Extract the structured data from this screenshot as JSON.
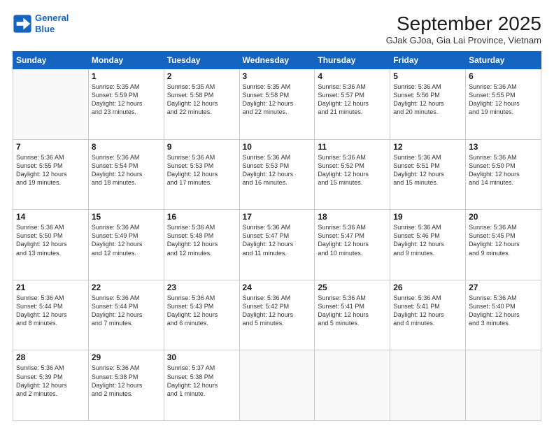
{
  "header": {
    "logo_line1": "General",
    "logo_line2": "Blue",
    "month_title": "September 2025",
    "location": "GJak GJoa, Gia Lai Province, Vietnam"
  },
  "days_of_week": [
    "Sunday",
    "Monday",
    "Tuesday",
    "Wednesday",
    "Thursday",
    "Friday",
    "Saturday"
  ],
  "weeks": [
    [
      {
        "day": "",
        "info": ""
      },
      {
        "day": "1",
        "info": "Sunrise: 5:35 AM\nSunset: 5:59 PM\nDaylight: 12 hours\nand 23 minutes."
      },
      {
        "day": "2",
        "info": "Sunrise: 5:35 AM\nSunset: 5:58 PM\nDaylight: 12 hours\nand 22 minutes."
      },
      {
        "day": "3",
        "info": "Sunrise: 5:35 AM\nSunset: 5:58 PM\nDaylight: 12 hours\nand 22 minutes."
      },
      {
        "day": "4",
        "info": "Sunrise: 5:36 AM\nSunset: 5:57 PM\nDaylight: 12 hours\nand 21 minutes."
      },
      {
        "day": "5",
        "info": "Sunrise: 5:36 AM\nSunset: 5:56 PM\nDaylight: 12 hours\nand 20 minutes."
      },
      {
        "day": "6",
        "info": "Sunrise: 5:36 AM\nSunset: 5:55 PM\nDaylight: 12 hours\nand 19 minutes."
      }
    ],
    [
      {
        "day": "7",
        "info": "Sunrise: 5:36 AM\nSunset: 5:55 PM\nDaylight: 12 hours\nand 19 minutes."
      },
      {
        "day": "8",
        "info": "Sunrise: 5:36 AM\nSunset: 5:54 PM\nDaylight: 12 hours\nand 18 minutes."
      },
      {
        "day": "9",
        "info": "Sunrise: 5:36 AM\nSunset: 5:53 PM\nDaylight: 12 hours\nand 17 minutes."
      },
      {
        "day": "10",
        "info": "Sunrise: 5:36 AM\nSunset: 5:53 PM\nDaylight: 12 hours\nand 16 minutes."
      },
      {
        "day": "11",
        "info": "Sunrise: 5:36 AM\nSunset: 5:52 PM\nDaylight: 12 hours\nand 15 minutes."
      },
      {
        "day": "12",
        "info": "Sunrise: 5:36 AM\nSunset: 5:51 PM\nDaylight: 12 hours\nand 15 minutes."
      },
      {
        "day": "13",
        "info": "Sunrise: 5:36 AM\nSunset: 5:50 PM\nDaylight: 12 hours\nand 14 minutes."
      }
    ],
    [
      {
        "day": "14",
        "info": "Sunrise: 5:36 AM\nSunset: 5:50 PM\nDaylight: 12 hours\nand 13 minutes."
      },
      {
        "day": "15",
        "info": "Sunrise: 5:36 AM\nSunset: 5:49 PM\nDaylight: 12 hours\nand 12 minutes."
      },
      {
        "day": "16",
        "info": "Sunrise: 5:36 AM\nSunset: 5:48 PM\nDaylight: 12 hours\nand 12 minutes."
      },
      {
        "day": "17",
        "info": "Sunrise: 5:36 AM\nSunset: 5:47 PM\nDaylight: 12 hours\nand 11 minutes."
      },
      {
        "day": "18",
        "info": "Sunrise: 5:36 AM\nSunset: 5:47 PM\nDaylight: 12 hours\nand 10 minutes."
      },
      {
        "day": "19",
        "info": "Sunrise: 5:36 AM\nSunset: 5:46 PM\nDaylight: 12 hours\nand 9 minutes."
      },
      {
        "day": "20",
        "info": "Sunrise: 5:36 AM\nSunset: 5:45 PM\nDaylight: 12 hours\nand 9 minutes."
      }
    ],
    [
      {
        "day": "21",
        "info": "Sunrise: 5:36 AM\nSunset: 5:44 PM\nDaylight: 12 hours\nand 8 minutes."
      },
      {
        "day": "22",
        "info": "Sunrise: 5:36 AM\nSunset: 5:44 PM\nDaylight: 12 hours\nand 7 minutes."
      },
      {
        "day": "23",
        "info": "Sunrise: 5:36 AM\nSunset: 5:43 PM\nDaylight: 12 hours\nand 6 minutes."
      },
      {
        "day": "24",
        "info": "Sunrise: 5:36 AM\nSunset: 5:42 PM\nDaylight: 12 hours\nand 5 minutes."
      },
      {
        "day": "25",
        "info": "Sunrise: 5:36 AM\nSunset: 5:41 PM\nDaylight: 12 hours\nand 5 minutes."
      },
      {
        "day": "26",
        "info": "Sunrise: 5:36 AM\nSunset: 5:41 PM\nDaylight: 12 hours\nand 4 minutes."
      },
      {
        "day": "27",
        "info": "Sunrise: 5:36 AM\nSunset: 5:40 PM\nDaylight: 12 hours\nand 3 minutes."
      }
    ],
    [
      {
        "day": "28",
        "info": "Sunrise: 5:36 AM\nSunset: 5:39 PM\nDaylight: 12 hours\nand 2 minutes."
      },
      {
        "day": "29",
        "info": "Sunrise: 5:36 AM\nSunset: 5:38 PM\nDaylight: 12 hours\nand 2 minutes."
      },
      {
        "day": "30",
        "info": "Sunrise: 5:37 AM\nSunset: 5:38 PM\nDaylight: 12 hours\nand 1 minute."
      },
      {
        "day": "",
        "info": ""
      },
      {
        "day": "",
        "info": ""
      },
      {
        "day": "",
        "info": ""
      },
      {
        "day": "",
        "info": ""
      }
    ]
  ]
}
